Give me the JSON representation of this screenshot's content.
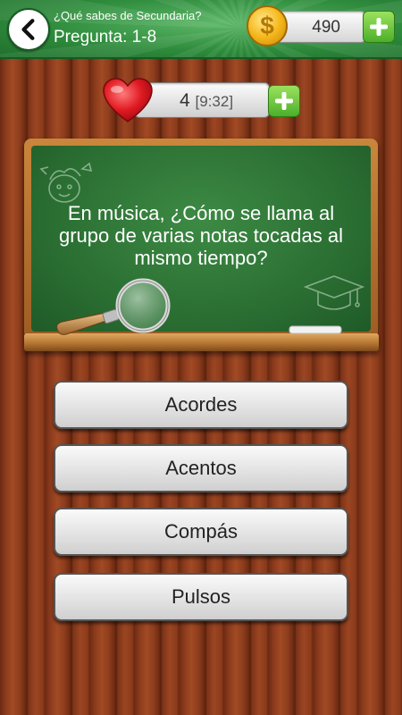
{
  "header": {
    "subtitle": "¿Qué sabes de Secundaria?",
    "title": "Pregunta: 1-8",
    "coins": "490"
  },
  "lives": {
    "count": "4",
    "timer": "[9:32]"
  },
  "question": {
    "text": "En música, ¿Cómo se llama al grupo de varias notas tocadas al mismo tiempo?"
  },
  "answers": [
    {
      "label": "Acordes"
    },
    {
      "label": "Acentos"
    },
    {
      "label": "Compás"
    },
    {
      "label": "Pulsos"
    }
  ],
  "icons": {
    "back": "back-arrow-icon",
    "coin": "coin-icon",
    "heart": "heart-icon",
    "plus": "plus-icon"
  },
  "colors": {
    "header_green": "#2f8d3d",
    "board_green": "#2b6f33",
    "plus_green": "#4caf2a",
    "heart_red": "#d4141c",
    "wood": "#8a3a1c"
  }
}
